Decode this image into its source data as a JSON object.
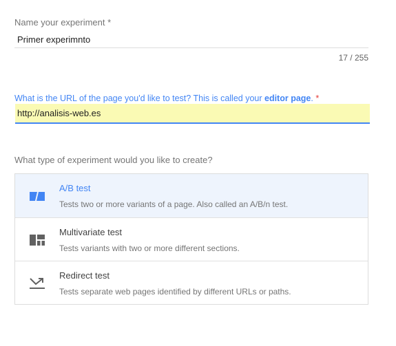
{
  "name_field": {
    "label": "Name your experiment *",
    "value": "Primer experimnto",
    "counter": "17 / 255"
  },
  "url_field": {
    "label_prefix": "What is the URL of the page you'd like to test? This is called your ",
    "label_emphasis": "editor page",
    "label_suffix": ".",
    "required_mark": "*",
    "value": "http://analisis-web.es"
  },
  "experiment_type": {
    "label": "What type of experiment would you like to create?",
    "selected": "A/B test",
    "options": [
      {
        "icon": "ab-test-icon",
        "title": "A/B test",
        "description": "Tests two or more variants of a page. Also called an A/B/n test."
      },
      {
        "icon": "multivariate-test-icon",
        "title": "Multivariate test",
        "description": "Tests variants with two or more different sections."
      },
      {
        "icon": "redirect-test-icon",
        "title": "Redirect test",
        "description": "Tests separate web pages identified by different URLs or paths."
      }
    ]
  },
  "colors": {
    "accent": "#4285f4",
    "required": "#e53935",
    "url_highlight": "#fafab4",
    "selected_row": "#eef4fd"
  }
}
